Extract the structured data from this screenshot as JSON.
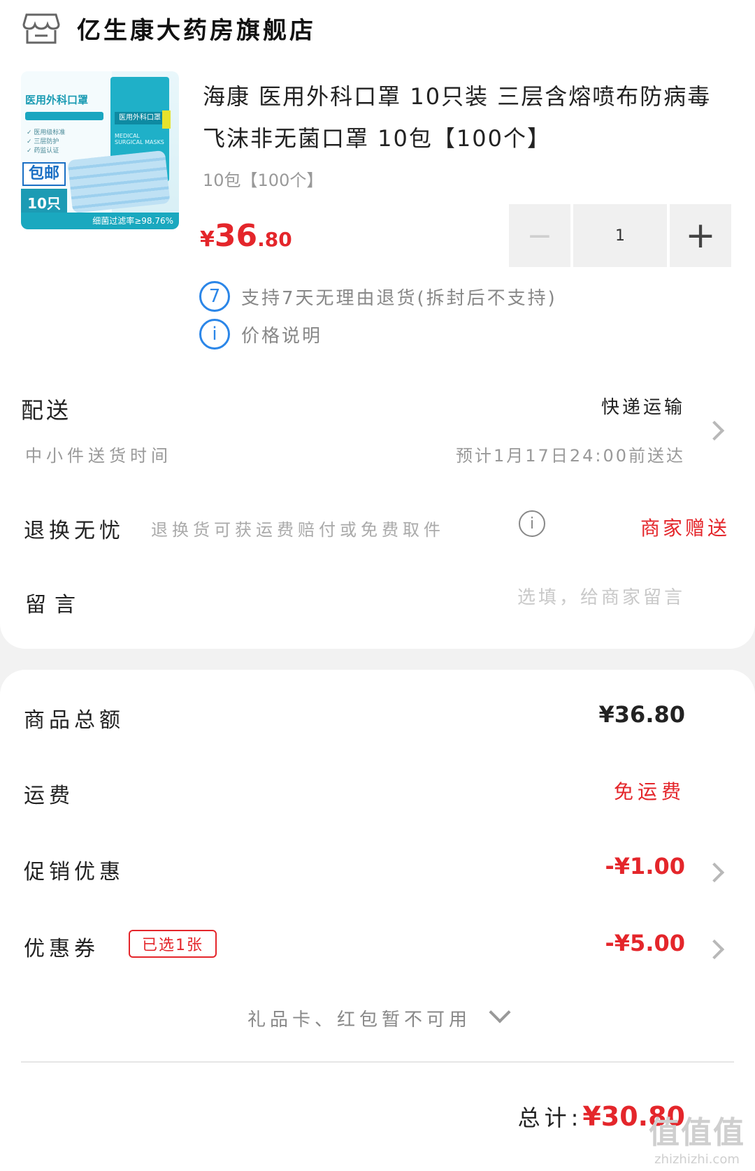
{
  "store": {
    "name": "亿生康大药房旗舰店",
    "icon": "store-icon"
  },
  "product": {
    "title": "海康 医用外科口罩 10只装 三层含熔喷布防病毒飞沫非无菌口罩 10包【100个】",
    "spec": "10包【100个】",
    "price": {
      "currency": "¥",
      "integer": "36",
      "decimal": ".80"
    },
    "quantity": {
      "minus": "−",
      "value": "1",
      "plus": "+"
    },
    "image": {
      "title": "医用外科口罩",
      "list": [
        "✓ 医用级标准",
        "✓ 三层防护",
        "✓ 药监认证"
      ],
      "badge": "包邮",
      "count": "10只装",
      "box_label": "医用外科口罩",
      "box_sub": "MEDICAL SURGICAL MASKS",
      "footer": "细菌过滤率≥98.76%"
    },
    "services": [
      {
        "icon": "7",
        "text": "支持7天无理由退货(拆封后不支持)"
      },
      {
        "icon": "i",
        "text": "价格说明"
      }
    ]
  },
  "delivery": {
    "label": "配送",
    "method": "快递运输",
    "sub": "中小件送货时间",
    "eta": "预计1月17日24:00前送达"
  },
  "returns": {
    "label": "退换无忧",
    "desc": "退换货可获运费赔付或免费取件",
    "status": "商家赠送"
  },
  "note": {
    "label": "留言",
    "placeholder": "选填，给商家留言"
  },
  "summary": {
    "goods_total_label": "商品总额",
    "goods_total_value": "¥36.80",
    "shipping_label": "运费",
    "shipping_value": "免运费",
    "promo_label": "促销优惠",
    "promo_value": "-¥1.00",
    "coupon_label": "优惠券",
    "coupon_badge": "已选1张",
    "coupon_value": "-¥5.00",
    "gift_text": "礼品卡、红包暂不可用"
  },
  "total": {
    "label": "总计:",
    "value": "¥30.80"
  },
  "watermark": {
    "logo": "值值值",
    "url": "zhizhizhi.com"
  },
  "colors": {
    "accent_red": "#e4262b",
    "service_blue": "#2b86e8",
    "background": "#f2f2f2"
  }
}
